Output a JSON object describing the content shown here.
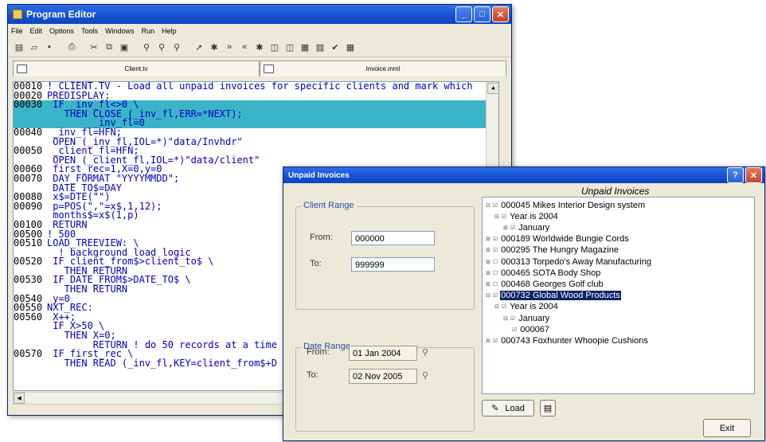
{
  "editor": {
    "title": "Program Editor",
    "menus": [
      "File",
      "Edit",
      "Options",
      "Tools",
      "Windows",
      "Run",
      "Help"
    ],
    "tabs": [
      {
        "name": "Client.tv"
      },
      {
        "name": "Invoice.mml"
      }
    ],
    "lines": [
      {
        "num": "00010",
        "text": "! CLIENT.TV - Load all unpaid invoices for specific clients and mark which",
        "hl": false
      },
      {
        "num": "00020",
        "text": "PREDISPLAY:",
        "hl": false
      },
      {
        "num": "00030",
        "text": " IF _inv_fl<>0 \\",
        "hl": true
      },
      {
        "num": "",
        "text": "   THEN CLOSE (_inv_fl,ERR=*NEXT);",
        "hl": true
      },
      {
        "num": "",
        "text": "        _inv_fl=0",
        "hl": true
      },
      {
        "num": "00040",
        "text": " _inv_fl=HFN;",
        "hl": false
      },
      {
        "num": "",
        "text": " OPEN (_inv_fl,IOL=*)\"data/Invhdr\"",
        "hl": false
      },
      {
        "num": "00050",
        "text": " _client_fl=HFN;",
        "hl": false
      },
      {
        "num": "",
        "text": " OPEN (_client_fl,IOL=*)\"data/client\"",
        "hl": false
      },
      {
        "num": "00060",
        "text": " first_rec=1,X=0,y=0",
        "hl": false
      },
      {
        "num": "00070",
        "text": " DAY_FORMAT \"YYYYMMDD\";",
        "hl": false
      },
      {
        "num": "",
        "text": " DATE_TO$=DAY",
        "hl": false
      },
      {
        "num": "00080",
        "text": " x$=DTE(\"\")",
        "hl": false
      },
      {
        "num": "00090",
        "text": " p=POS(\",\"=x$,1,12);",
        "hl": false
      },
      {
        "num": "",
        "text": " months$=x$(1,p)",
        "hl": false
      },
      {
        "num": "00100",
        "text": " RETURN",
        "hl": false
      },
      {
        "num": "00500",
        "text": "! 500",
        "hl": false
      },
      {
        "num": "00510",
        "text": "LOAD_TREEVIEW: \\",
        "hl": false
      },
      {
        "num": "",
        "text": "  ! background load logic",
        "hl": false
      },
      {
        "num": "00520",
        "text": " IF client_from$>client_to$ \\",
        "hl": false
      },
      {
        "num": "",
        "text": "   THEN RETURN",
        "hl": false
      },
      {
        "num": "00530",
        "text": " IF DATE_FROM$>DATE_TO$ \\",
        "hl": false
      },
      {
        "num": "",
        "text": "   THEN RETURN",
        "hl": false
      },
      {
        "num": "00540",
        "text": " y=0",
        "hl": false
      },
      {
        "num": "00550",
        "text": "NXT_REC:",
        "hl": false
      },
      {
        "num": "00560",
        "text": " X++;",
        "hl": false
      },
      {
        "num": "",
        "text": " IF X>50 \\",
        "hl": false
      },
      {
        "num": "",
        "text": "   THEN X=0;",
        "hl": false
      },
      {
        "num": "",
        "text": "        RETURN ! do 50 records at a time",
        "hl": false
      },
      {
        "num": "00570",
        "text": " IF first_rec \\",
        "hl": false
      },
      {
        "num": "",
        "text": "   THEN READ (_inv_fl,KEY=client_from$+D",
        "hl": false
      }
    ]
  },
  "dialog": {
    "title": "Unpaid Invoices",
    "client_range": {
      "legend": "Client Range",
      "from_label": "From:",
      "from_value": "000000",
      "to_label": "To:",
      "to_value": "999999"
    },
    "date_range": {
      "legend": "Date Range",
      "from_label": "From:",
      "from_value": "01 Jan 2004",
      "to_label": "To:",
      "to_value": "02 Nov 2005"
    },
    "tree_title": "Unpaid Invoices",
    "tree": [
      {
        "level": 0,
        "pm": "⊟",
        "check": "☑",
        "text": "000045  Mikes Interior Design system",
        "sel": false
      },
      {
        "level": 1,
        "pm": "⊟",
        "check": "☑",
        "text": "Year is 2004",
        "sel": false
      },
      {
        "level": 2,
        "pm": "⊞",
        "check": "☑",
        "text": "January",
        "sel": false
      },
      {
        "level": 0,
        "pm": "⊞",
        "check": "☑",
        "text": "000189  Worldwide Bungie Cords",
        "sel": false
      },
      {
        "level": 0,
        "pm": "⊞",
        "check": "☑",
        "text": "000295  The Hungry Magazine",
        "sel": false
      },
      {
        "level": 0,
        "pm": "⊞",
        "check": "☐",
        "text": "000313  Torpedo's Away Manufacturing",
        "sel": false
      },
      {
        "level": 0,
        "pm": "⊞",
        "check": "☐",
        "text": "000465  SOTA Body Shop",
        "sel": false
      },
      {
        "level": 0,
        "pm": "⊞",
        "check": "☐",
        "text": "000468  Georges Golf club",
        "sel": false
      },
      {
        "level": 0,
        "pm": "⊟",
        "check": "☑",
        "text": "000732  Global Wood Products",
        "sel": true
      },
      {
        "level": 1,
        "pm": "⊟",
        "check": "☑",
        "text": "Year is 2004",
        "sel": false
      },
      {
        "level": 2,
        "pm": "⊟",
        "check": "☑",
        "text": "January",
        "sel": false
      },
      {
        "level": 3,
        "pm": "",
        "check": "☑",
        "text": "000067",
        "sel": false
      },
      {
        "level": 0,
        "pm": "⊞",
        "check": "☑",
        "text": "000743  Foxhunter Whoopie Cushions",
        "sel": false
      }
    ],
    "load_label": "Load",
    "exit_label": "Exit"
  }
}
